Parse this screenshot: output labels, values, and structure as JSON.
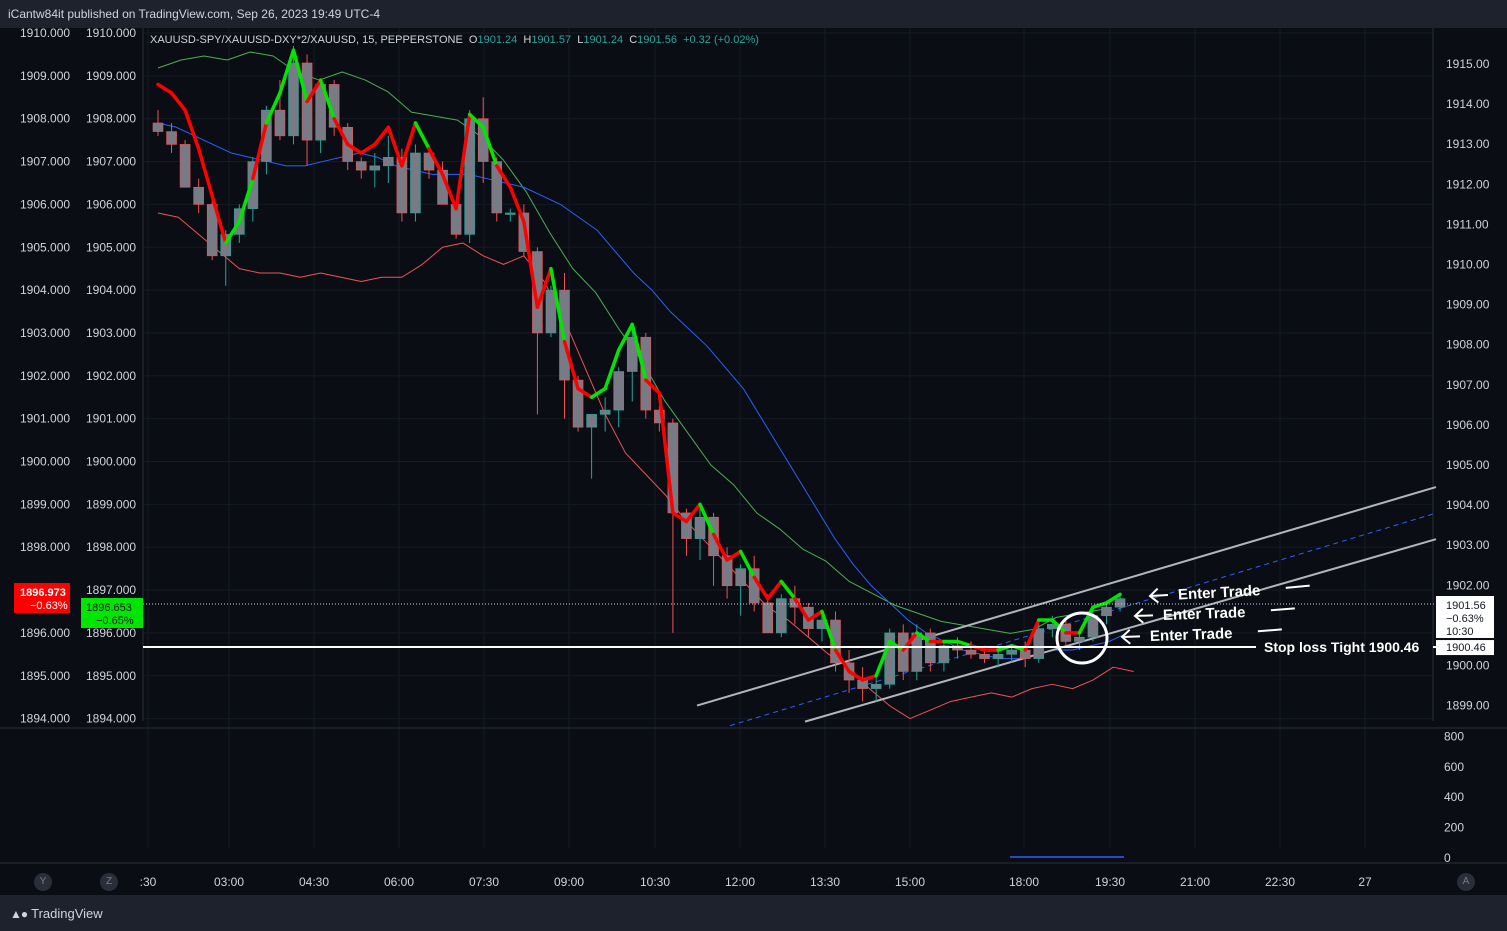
{
  "header": {
    "published": "iCantw84it published on TradingView.com, Sep 26, 2023 19:49 UTC-4"
  },
  "legend": {
    "symbol": "XAUUSD-SPY/XAUUSD-DXY*2/XAUUSD, 15, PEPPERSTONE",
    "o_label": "O",
    "o": "1901.24",
    "h_label": "H",
    "h": "1901.57",
    "l_label": "L",
    "l": "1901.24",
    "c_label": "C",
    "c": "1901.56",
    "change": "+0.32 (+0.02%)"
  },
  "footer": {
    "brand": "TradingView"
  },
  "buttons": {
    "y": "Y",
    "z": "Z",
    "a": "A"
  },
  "colors": {
    "background": "#0b0d14",
    "candle": "#787b86",
    "fast_line_up": "#00e600",
    "fast_line_down": "#ff0000",
    "band_upper": "#4caf50",
    "band_lower": "#ef5350",
    "basis": "#2962ff",
    "channel": "#b2b5be",
    "channel_mid": "#2962ff",
    "badge_red": "#ff0000",
    "badge_green": "#00e600"
  },
  "chart_data": {
    "type": "candlestick",
    "x_ticks": [
      ":30",
      "03:00",
      "04:30",
      "06:00",
      "07:30",
      "09:00",
      "10:30",
      "12:00",
      "13:30",
      "15:00",
      "18:00",
      "19:30",
      "21:00",
      "22:30",
      "27"
    ],
    "left_axis_outer_ticks": [
      "1910.000",
      "1909.000",
      "1908.000",
      "1907.000",
      "1906.000",
      "1905.000",
      "1904.000",
      "1903.000",
      "1902.000",
      "1901.000",
      "1900.000",
      "1899.000",
      "1898.000",
      "1897.000",
      "1896.000",
      "1895.000",
      "1894.000"
    ],
    "left_axis_inner_ticks": [
      "1910.000",
      "1909.000",
      "1908.000",
      "1907.000",
      "1906.000",
      "1905.000",
      "1904.000",
      "1903.000",
      "1902.000",
      "1901.000",
      "1900.000",
      "1899.000",
      "1898.000",
      "1897.000",
      "1896.000",
      "1895.000",
      "1894.000"
    ],
    "right_axis_ticks": [
      "1915.00",
      "1914.00",
      "1913.00",
      "1912.00",
      "1911.00",
      "1910.00",
      "1909.00",
      "1908.00",
      "1907.00",
      "1906.00",
      "1905.00",
      "1904.00",
      "1903.00",
      "1902.00",
      "1901.00",
      "1900.00",
      "1899.00"
    ],
    "ylim_left": [
      1893.7,
      1910.2
    ],
    "ylim_right": [
      1898.6,
      1916.2
    ],
    "volume_ticks": [
      "800",
      "600",
      "400",
      "200",
      "0"
    ],
    "volume_ylim": [
      0,
      800
    ],
    "badges": {
      "left_outer": {
        "value": "1896.973",
        "change": "−0.63%"
      },
      "left_inner": {
        "value": "1896.653",
        "change": "−0.65%"
      },
      "right": {
        "value": "1901.56",
        "change": "−0.63%",
        "time": "10:30"
      },
      "right_stop": {
        "value": "1900.46"
      }
    },
    "stop_loss": {
      "label": "Stop loss Tight 1900.46",
      "value": 1900.46
    },
    "annotations": [
      "Enter Trade",
      "Enter Trade",
      "Enter Trade"
    ],
    "candles": [
      [
        1907.9,
        1908.2,
        1907.6,
        1907.7
      ],
      [
        1907.7,
        1907.9,
        1907.2,
        1907.4
      ],
      [
        1907.4,
        1907.5,
        1906.6,
        1906.4
      ],
      [
        1906.4,
        1906.6,
        1905.8,
        1906.0
      ],
      [
        1906.0,
        1906.1,
        1904.7,
        1904.8
      ],
      [
        1904.8,
        1905.4,
        1904.1,
        1905.3
      ],
      [
        1905.3,
        1906.0,
        1905.1,
        1905.9
      ],
      [
        1905.9,
        1907.1,
        1905.6,
        1907.0
      ],
      [
        1907.0,
        1908.3,
        1906.7,
        1908.2
      ],
      [
        1908.2,
        1908.9,
        1907.5,
        1907.6
      ],
      [
        1907.6,
        1909.7,
        1907.4,
        1909.3
      ],
      [
        1909.3,
        1909.5,
        1906.9,
        1907.5
      ],
      [
        1907.5,
        1908.9,
        1907.2,
        1908.8
      ],
      [
        1908.8,
        1908.9,
        1907.6,
        1907.8
      ],
      [
        1907.8,
        1907.9,
        1906.8,
        1907.0
      ],
      [
        1907.0,
        1907.1,
        1906.6,
        1906.8
      ],
      [
        1906.8,
        1907.2,
        1906.4,
        1906.9
      ],
      [
        1906.9,
        1907.6,
        1906.5,
        1907.1
      ],
      [
        1907.1,
        1907.3,
        1905.6,
        1905.8
      ],
      [
        1905.8,
        1907.4,
        1905.6,
        1907.2
      ],
      [
        1907.2,
        1907.3,
        1906.6,
        1906.8
      ],
      [
        1906.8,
        1907.0,
        1906.1,
        1906.0
      ],
      [
        1906.0,
        1906.1,
        1905.2,
        1905.3
      ],
      [
        1905.3,
        1908.2,
        1905.1,
        1908.0
      ],
      [
        1908.0,
        1908.5,
        1906.5,
        1907.0
      ],
      [
        1907.0,
        1907.1,
        1905.6,
        1905.8
      ],
      [
        1905.8,
        1905.9,
        1905.6,
        1905.8
      ],
      [
        1905.8,
        1906.0,
        1904.8,
        1904.9
      ],
      [
        1904.9,
        1905.0,
        1901.1,
        1903.0
      ],
      [
        1903.0,
        1904.1,
        1902.9,
        1904.0
      ],
      [
        1904.0,
        1904.4,
        1901.0,
        1901.9
      ],
      [
        1901.9,
        1902.0,
        1900.7,
        1900.8
      ],
      [
        1900.8,
        1901.1,
        1899.6,
        1901.1
      ],
      [
        1901.1,
        1901.5,
        1900.7,
        1901.2
      ],
      [
        1901.2,
        1902.2,
        1900.8,
        1902.1
      ],
      [
        1902.1,
        1903.1,
        1901.4,
        1902.9
      ],
      [
        1902.9,
        1903.0,
        1901.0,
        1901.2
      ],
      [
        1901.2,
        1901.3,
        1900.7,
        1900.9
      ],
      [
        1900.9,
        1901.0,
        1896.0,
        1898.8
      ],
      [
        1898.8,
        1898.9,
        1897.8,
        1898.2
      ],
      [
        1898.2,
        1898.9,
        1897.7,
        1898.7
      ],
      [
        1898.7,
        1898.8,
        1897.1,
        1897.8
      ],
      [
        1897.8,
        1898.0,
        1896.8,
        1897.1
      ],
      [
        1897.1,
        1897.6,
        1896.4,
        1897.5
      ],
      [
        1897.5,
        1897.8,
        1896.5,
        1896.7
      ],
      [
        1896.7,
        1896.9,
        1896.2,
        1896.0
      ],
      [
        1896.0,
        1896.9,
        1895.9,
        1896.8
      ],
      [
        1896.8,
        1897.1,
        1896.2,
        1896.6
      ],
      [
        1896.6,
        1896.7,
        1895.9,
        1896.1
      ],
      [
        1896.1,
        1896.4,
        1895.8,
        1896.3
      ],
      [
        1896.3,
        1896.5,
        1895.1,
        1895.3
      ],
      [
        1895.3,
        1895.6,
        1894.6,
        1894.9
      ],
      [
        1894.9,
        1895.2,
        1894.4,
        1894.7
      ],
      [
        1894.7,
        1895.0,
        1894.4,
        1894.8
      ],
      [
        1894.8,
        1896.1,
        1894.7,
        1896.0
      ],
      [
        1896.0,
        1896.2,
        1894.9,
        1895.1
      ],
      [
        1895.1,
        1896.2,
        1894.9,
        1896.0
      ],
      [
        1896.0,
        1896.1,
        1895.1,
        1895.3
      ],
      [
        1895.3,
        1895.8,
        1895.1,
        1895.7
      ],
      [
        1895.7,
        1895.9,
        1895.4,
        1895.6
      ],
      [
        1895.6,
        1895.8,
        1895.4,
        1895.5
      ],
      [
        1895.5,
        1895.7,
        1895.3,
        1895.4
      ],
      [
        1895.4,
        1895.6,
        1895.2,
        1895.5
      ],
      [
        1895.5,
        1895.7,
        1895.3,
        1895.6
      ],
      [
        1895.6,
        1895.8,
        1895.2,
        1895.4
      ],
      [
        1895.4,
        1896.3,
        1895.3,
        1896.1
      ],
      [
        1896.1,
        1896.4,
        1895.9,
        1896.2
      ],
      [
        1896.2,
        1896.3,
        1895.7,
        1895.8
      ],
      [
        1895.8,
        1896.0,
        1895.6,
        1895.9
      ],
      [
        1895.9,
        1896.5,
        1895.8,
        1896.4
      ],
      [
        1896.4,
        1896.7,
        1896.2,
        1896.6
      ],
      [
        1896.6,
        1896.9,
        1896.5,
        1896.8
      ]
    ],
    "fast_line": [
      1908.8,
      1908.6,
      1908.2,
      1907.3,
      1906.2,
      1905.1,
      1905.6,
      1906.6,
      1907.9,
      1908.6,
      1909.6,
      1908.4,
      1908.9,
      1908.0,
      1907.4,
      1907.2,
      1907.4,
      1907.8,
      1906.9,
      1907.9,
      1907.3,
      1906.7,
      1905.9,
      1908.1,
      1907.8,
      1906.9,
      1906.4,
      1905.6,
      1903.6,
      1904.5,
      1902.8,
      1901.7,
      1901.5,
      1901.7,
      1902.6,
      1903.2,
      1901.9,
      1901.6,
      1898.8,
      1898.6,
      1899.0,
      1898.3,
      1897.7,
      1897.9,
      1897.3,
      1896.8,
      1897.2,
      1896.8,
      1896.3,
      1896.5,
      1895.6,
      1895.1,
      1894.9,
      1895.0,
      1895.8,
      1895.6,
      1896.0,
      1895.8,
      1895.8,
      1895.8,
      1895.7,
      1895.6,
      1895.6,
      1895.7,
      1895.6,
      1896.3,
      1896.3,
      1896.0,
      1896.0,
      1896.6,
      1896.7,
      1896.9
    ],
    "fast_line_dir": [
      0,
      0,
      0,
      0,
      0,
      1,
      1,
      0,
      1,
      1,
      1,
      0,
      1,
      0,
      0,
      0,
      0,
      0,
      0,
      1,
      0,
      0,
      0,
      1,
      1,
      0,
      0,
      0,
      0,
      1,
      0,
      0,
      1,
      1,
      1,
      1,
      0,
      0,
      0,
      0,
      1,
      0,
      0,
      1,
      0,
      0,
      1,
      0,
      0,
      1,
      0,
      0,
      0,
      1,
      1,
      0,
      1,
      0,
      1,
      1,
      0,
      0,
      1,
      1,
      0,
      1,
      1,
      0,
      1,
      1,
      1,
      0
    ],
    "band_upper_right": [
      1914.9,
      1915.1,
      1915.2,
      1915.1,
      1915.3,
      1915.2,
      1914.8,
      1914.6,
      1914.8,
      1914.6,
      1914.3,
      1913.8,
      1913.7,
      1913.6,
      1913.2,
      1912.6,
      1911.8,
      1910.8,
      1909.9,
      1909.3,
      1908.4,
      1907.6,
      1906.6,
      1905.8,
      1905.0,
      1904.5,
      1903.8,
      1903.4,
      1902.9,
      1902.6,
      1902.1,
      1901.8,
      1901.5,
      1901.3,
      1901.1,
      1901.0,
      1900.9,
      1900.8,
      1900.9,
      1901.2,
      1901.3,
      1901.4
    ],
    "band_lower_left": [
      1905.8,
      1905.7,
      1905.3,
      1904.9,
      1904.5,
      1904.4,
      1904.4,
      1904.3,
      1904.4,
      1904.3,
      1904.2,
      1904.3,
      1904.3,
      1904.6,
      1905.0,
      1905.1,
      1904.8,
      1904.6,
      1904.8,
      1904.2,
      1903.3,
      1902.2,
      1901.1,
      1900.2,
      1899.7,
      1899.2,
      1898.6,
      1898.1,
      1897.6,
      1897.1,
      1896.6,
      1896.3,
      1895.9,
      1895.5,
      1895.2,
      1894.7,
      1894.3,
      1894.0,
      1894.2,
      1894.4,
      1894.5,
      1894.6,
      1894.5,
      1894.7,
      1894.8,
      1894.7,
      1894.9,
      1895.2,
      1895.1
    ],
    "basis_left": [
      1907.9,
      1907.8,
      1907.6,
      1907.4,
      1907.2,
      1907.1,
      1907.0,
      1906.9,
      1906.9,
      1907.0,
      1907.1,
      1907.2,
      1907.1,
      1906.9,
      1906.8,
      1906.7,
      1906.7,
      1906.7,
      1906.6,
      1906.5,
      1906.4,
      1906.2,
      1906.0,
      1905.7,
      1905.4,
      1904.9,
      1904.4,
      1904.0,
      1903.5,
      1903.1,
      1902.7,
      1902.2,
      1901.7,
      1901.0,
      1900.3,
      1899.6,
      1898.9,
      1898.2,
      1897.6,
      1897.1,
      1896.7,
      1896.3,
      1896.0,
      1895.8,
      1895.6,
      1895.5,
      1895.4,
      1895.4,
      1895.5,
      1895.6,
      1895.6,
      1895.7,
      1895.8,
      1896.0
    ]
  }
}
